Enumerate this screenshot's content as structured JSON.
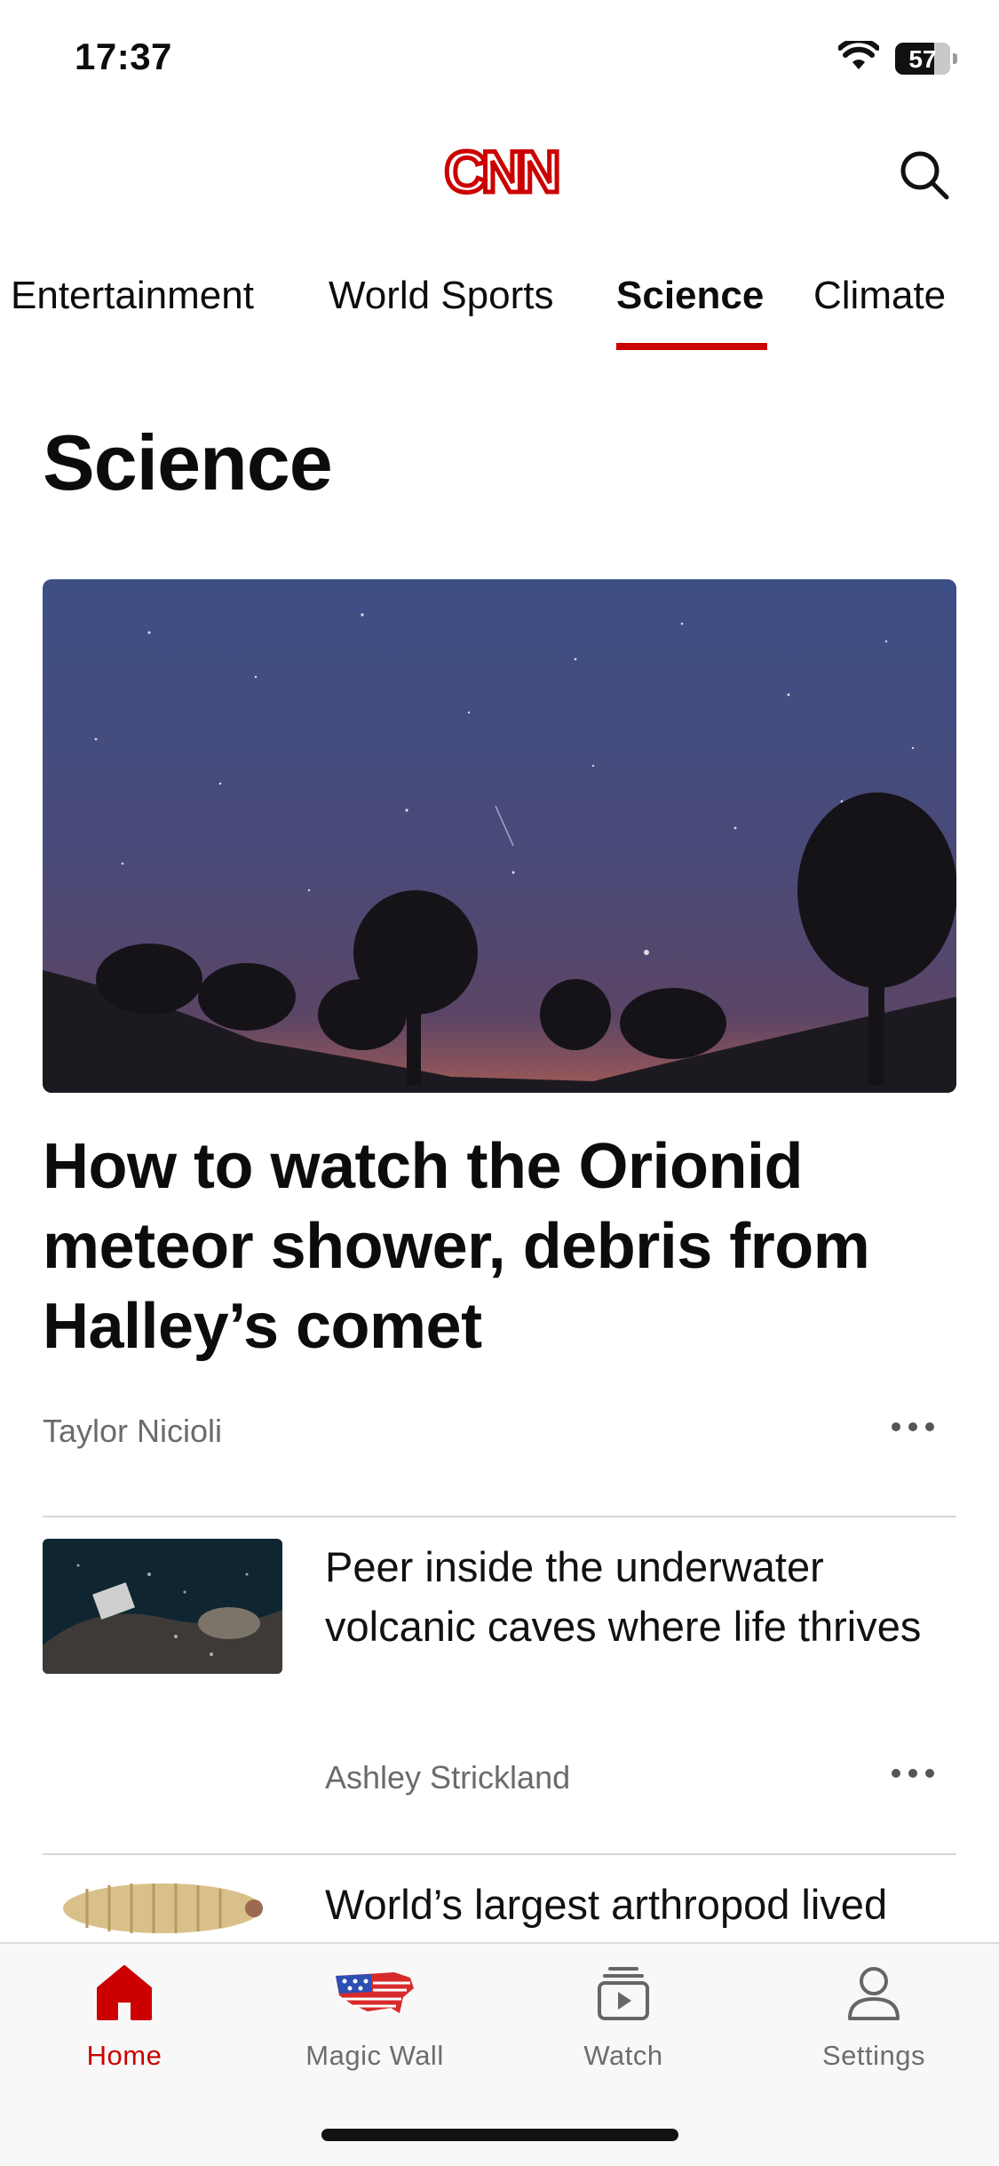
{
  "status": {
    "time": "17:37",
    "battery": "57"
  },
  "header": {
    "logo": "CNN",
    "search_icon": "search-icon"
  },
  "tabs": [
    {
      "label": "Entertainment",
      "active": false
    },
    {
      "label": "World Sports",
      "active": false
    },
    {
      "label": "Science",
      "active": true
    },
    {
      "label": "Climate",
      "active": false
    }
  ],
  "section": {
    "title": "Science"
  },
  "hero": {
    "title": "How to watch the Orionid meteor shower, debris from Halley’s comet",
    "author": "Taylor Nicioli",
    "image_icon": "night-sky-trees-image"
  },
  "articles": [
    {
      "title": "Peer inside the underwater volcanic caves where life thrives",
      "author": "Ashley Strickland",
      "image_icon": "underwater-cave-image"
    },
    {
      "title": "World’s largest arthropod lived",
      "author": "",
      "image_icon": "arthropod-fossil-image"
    }
  ],
  "bottom_nav": [
    {
      "label": "Home",
      "icon": "home-icon",
      "active": true
    },
    {
      "label": "Magic Wall",
      "icon": "us-map-flag-icon",
      "active": false
    },
    {
      "label": "Watch",
      "icon": "play-tv-icon",
      "active": false
    },
    {
      "label": "Settings",
      "icon": "person-icon",
      "active": false
    }
  ],
  "colors": {
    "accent": "#cc0000",
    "text": "#0c0c0c",
    "muted": "#6b6b6b"
  }
}
